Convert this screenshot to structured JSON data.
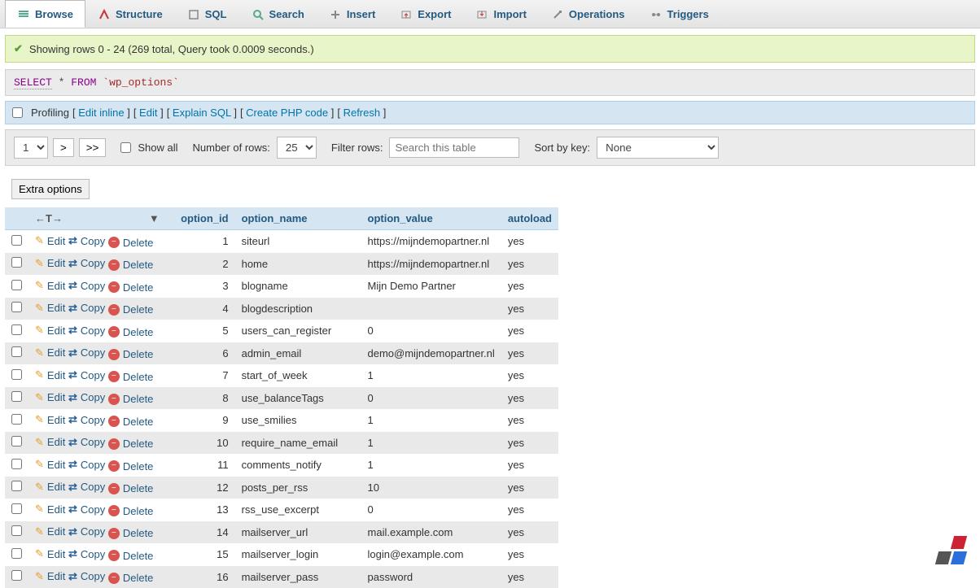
{
  "tabs": [
    {
      "id": "browse",
      "label": "Browse",
      "active": true
    },
    {
      "id": "structure",
      "label": "Structure"
    },
    {
      "id": "sql",
      "label": "SQL"
    },
    {
      "id": "search",
      "label": "Search"
    },
    {
      "id": "insert",
      "label": "Insert"
    },
    {
      "id": "export",
      "label": "Export"
    },
    {
      "id": "import",
      "label": "Import"
    },
    {
      "id": "operations",
      "label": "Operations"
    },
    {
      "id": "triggers",
      "label": "Triggers"
    }
  ],
  "notice": "Showing rows 0 - 24 (269 total, Query took 0.0009 seconds.)",
  "sql": {
    "select": "SELECT",
    "star": "*",
    "from": "FROM",
    "table": "`wp_options`"
  },
  "linkbar": {
    "profiling": "Profiling",
    "edit_inline": "Edit inline",
    "edit": "Edit",
    "explain": "Explain SQL",
    "php": "Create PHP code",
    "refresh": "Refresh"
  },
  "controls": {
    "page": "1",
    "next": ">",
    "last": ">>",
    "showall": "Show all",
    "numrows_label": "Number of rows:",
    "numrows": "25",
    "filter_label": "Filter rows:",
    "filter_placeholder": "Search this table",
    "sort_label": "Sort by key:",
    "sort": "None"
  },
  "extra": "Extra options",
  "columns": {
    "tt": "←T→",
    "option_id": "option_id",
    "option_name": "option_name",
    "option_value": "option_value",
    "autoload": "autoload"
  },
  "actions": {
    "edit": "Edit",
    "copy": "Copy",
    "delete": "Delete"
  },
  "rows": [
    {
      "id": "1",
      "name": "siteurl",
      "value": "https://mijndemopartner.nl",
      "autoload": "yes"
    },
    {
      "id": "2",
      "name": "home",
      "value": "https://mijndemopartner.nl",
      "autoload": "yes"
    },
    {
      "id": "3",
      "name": "blogname",
      "value": "Mijn Demo Partner",
      "autoload": "yes"
    },
    {
      "id": "4",
      "name": "blogdescription",
      "value": "",
      "autoload": "yes"
    },
    {
      "id": "5",
      "name": "users_can_register",
      "value": "0",
      "autoload": "yes"
    },
    {
      "id": "6",
      "name": "admin_email",
      "value": "demo@mijndemopartner.nl",
      "autoload": "yes"
    },
    {
      "id": "7",
      "name": "start_of_week",
      "value": "1",
      "autoload": "yes"
    },
    {
      "id": "8",
      "name": "use_balanceTags",
      "value": "0",
      "autoload": "yes"
    },
    {
      "id": "9",
      "name": "use_smilies",
      "value": "1",
      "autoload": "yes"
    },
    {
      "id": "10",
      "name": "require_name_email",
      "value": "1",
      "autoload": "yes"
    },
    {
      "id": "11",
      "name": "comments_notify",
      "value": "1",
      "autoload": "yes"
    },
    {
      "id": "12",
      "name": "posts_per_rss",
      "value": "10",
      "autoload": "yes"
    },
    {
      "id": "13",
      "name": "rss_use_excerpt",
      "value": "0",
      "autoload": "yes"
    },
    {
      "id": "14",
      "name": "mailserver_url",
      "value": "mail.example.com",
      "autoload": "yes"
    },
    {
      "id": "15",
      "name": "mailserver_login",
      "value": "login@example.com",
      "autoload": "yes"
    },
    {
      "id": "16",
      "name": "mailserver_pass",
      "value": "password",
      "autoload": "yes"
    }
  ]
}
